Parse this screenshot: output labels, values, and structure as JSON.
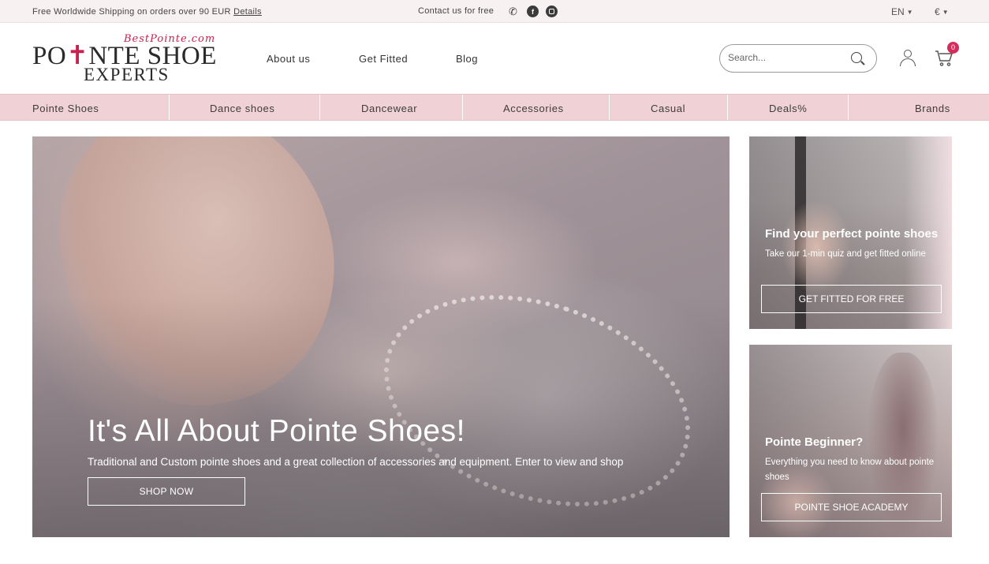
{
  "topbar": {
    "shipping_text": "Free Worldwide Shipping on orders over 90 EUR",
    "details_link": "Details",
    "contact_text": "Contact us for free",
    "language": "EN",
    "currency": "€"
  },
  "logo": {
    "site": "BestPointe.com",
    "line1_a": "PO",
    "line1_b": "NTE SHOE",
    "line2": "EXPERTS"
  },
  "mainnav": [
    "About us",
    "Get Fitted",
    "Blog"
  ],
  "search": {
    "placeholder": "Search..."
  },
  "cart": {
    "count": "0"
  },
  "categories": [
    "Pointe Shoes",
    "Dance shoes",
    "Dancewear",
    "Accessories",
    "Casual",
    "Deals%",
    "Brands"
  ],
  "hero": {
    "title": "It's All About Pointe Shoes!",
    "subtitle": "Traditional and Custom pointe shoes and a great collection of accessories and equipment. Enter to view and shop",
    "button": "SHOP NOW"
  },
  "promos": [
    {
      "title": "Find your perfect pointe shoes",
      "description": "Take our 1-min quiz and get fitted online",
      "button": "GET FITTED FOR FREE"
    },
    {
      "title": "Pointe Beginner?",
      "description": "Everything you need to know about pointe shoes",
      "button": "POINTE SHOE ACADEMY"
    }
  ]
}
